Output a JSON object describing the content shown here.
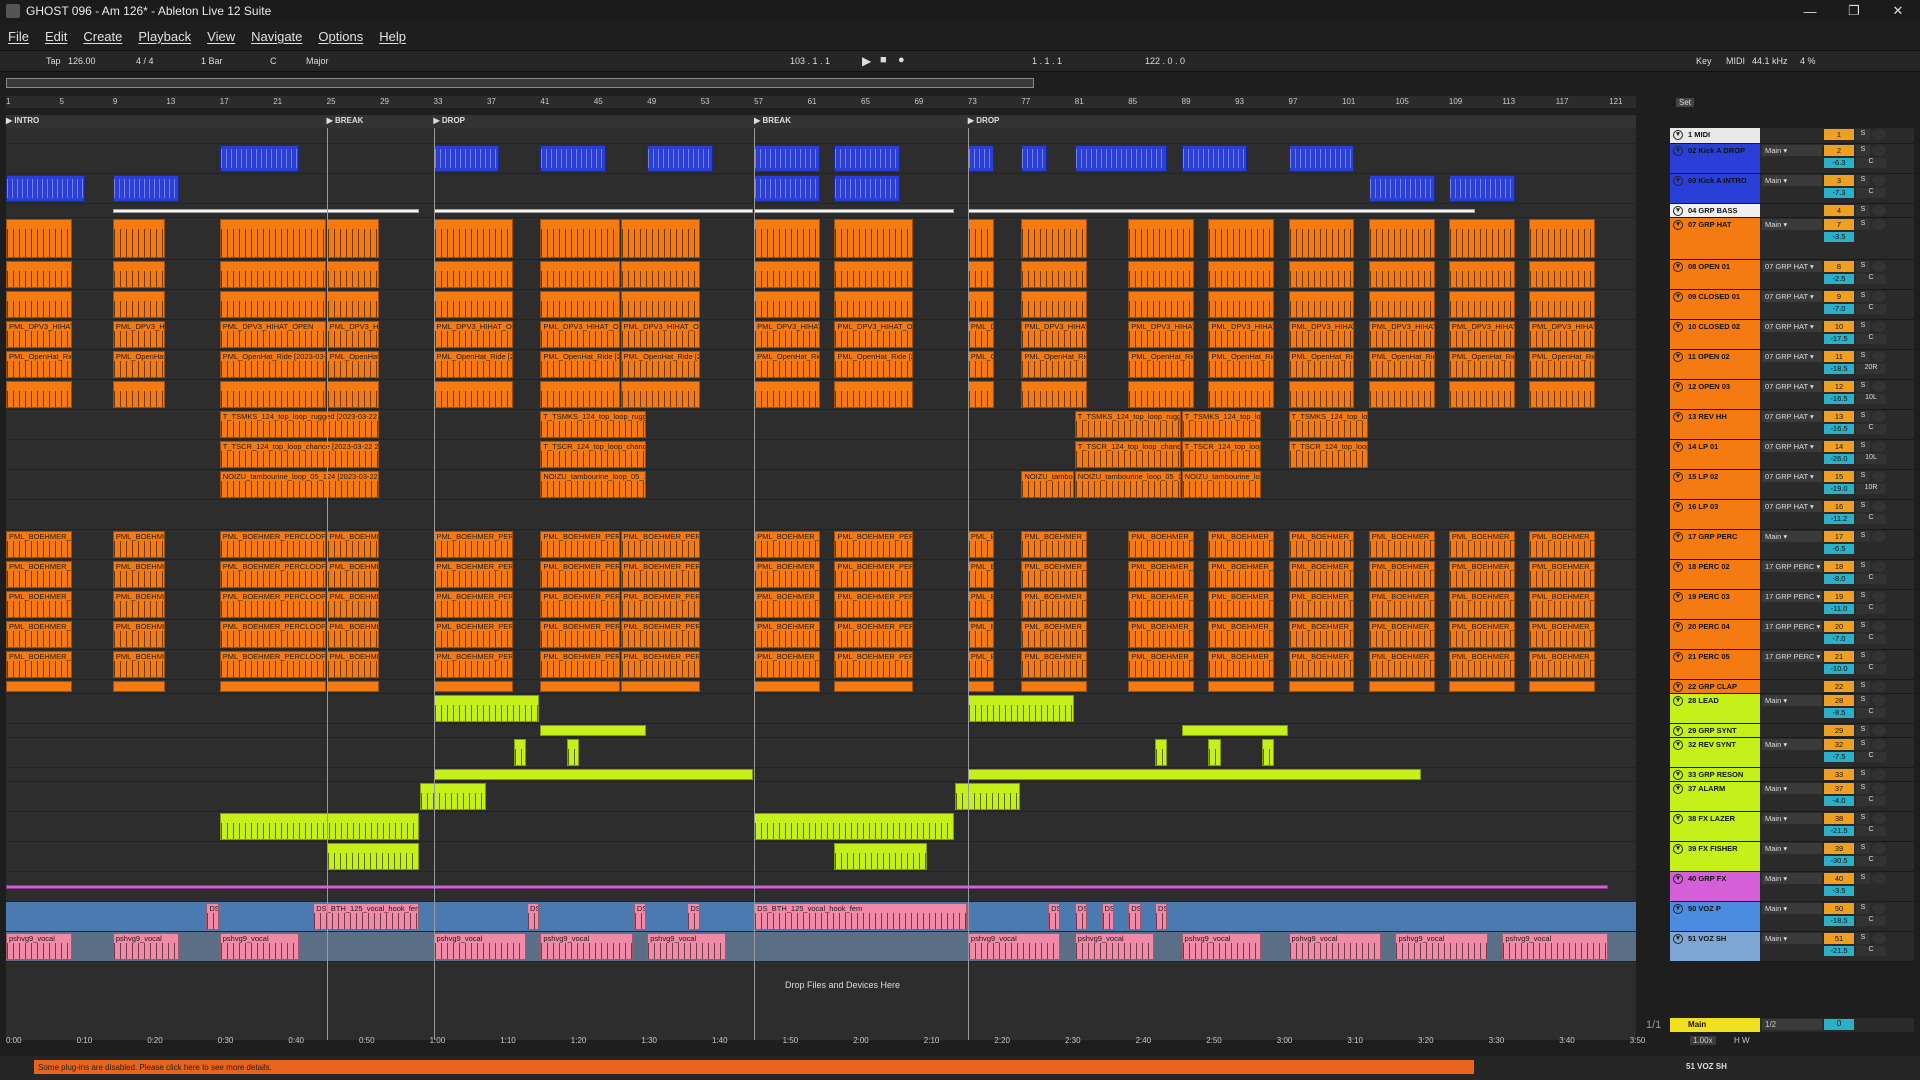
{
  "window": {
    "title": "GHOST 096 - Am 126* - Ableton Live 12 Suite",
    "min": "—",
    "max": "❐",
    "close": "✕"
  },
  "menu": [
    "File",
    "Edit",
    "Create",
    "View",
    "Playback",
    "Navigate",
    "Options",
    "Help"
  ],
  "transport": {
    "tap": "Tap",
    "tempo": "126.00",
    "signature": "4 / 4",
    "quant": "1 Bar",
    "key": "C",
    "scale": "Major",
    "position": "103 .  1 .  1",
    "loop_start": "1 .  1 .  1",
    "loop_len": "122 .  0 .  0",
    "key_label": "Key",
    "midi_label": "MIDI",
    "samplerate": "44.1 kHz",
    "cpu": "4 %"
  },
  "bar_labels": [
    "1",
    "5",
    "9",
    "13",
    "17",
    "21",
    "25",
    "29",
    "33",
    "37",
    "41",
    "45",
    "49",
    "53",
    "57",
    "61",
    "65",
    "69",
    "73",
    "77",
    "81",
    "85",
    "89",
    "93",
    "97",
    "101",
    "105",
    "109",
    "113",
    "117",
    "121"
  ],
  "locators": [
    {
      "label": "INTRO",
      "bar": 1
    },
    {
      "label": "BREAK",
      "bar": 25
    },
    {
      "label": "DROP",
      "bar": 33
    },
    {
      "label": "BREAK",
      "bar": 57
    },
    {
      "label": "DROP",
      "bar": 73
    }
  ],
  "time_labels": [
    "0:00",
    "0:10",
    "0:20",
    "0:30",
    "0:40",
    "0:50",
    "1:00",
    "1:10",
    "1:20",
    "1:30",
    "1:40",
    "1:50",
    "2:00",
    "2:10",
    "2:20",
    "2:30",
    "2:40",
    "2:50",
    "3:00",
    "3:10",
    "3:20",
    "3:30",
    "3:40",
    "3:50"
  ],
  "set_label": "Set",
  "drop_text": "Drop Files and Devices Here",
  "page_count": "1/1",
  "tracks": [
    {
      "name": "1 MIDI",
      "color": "#e8e8e8",
      "h": 16,
      "num": "1",
      "route": "",
      "vol": "",
      "pan": ""
    },
    {
      "name": "02 Kick A DROP",
      "color": "#2a3fd8",
      "h": 30,
      "num": "2",
      "route": "Main",
      "vol": "-6.3",
      "pan": "C"
    },
    {
      "name": "03 Kick A INTRO",
      "color": "#2a3fd8",
      "h": 30,
      "num": "3",
      "route": "Main",
      "vol": "-7.3",
      "pan": "C"
    },
    {
      "name": "04 GRP BASS",
      "color": "#f0f0f0",
      "h": 14,
      "num": "4",
      "route": "",
      "vol": "",
      "pan": ""
    },
    {
      "name": "07 GRP HAT",
      "color": "#f57a12",
      "h": 42,
      "num": "7",
      "route": "Main",
      "vol": "-3.5",
      "pan": ""
    },
    {
      "name": "08 OPEN 01",
      "color": "#f57a12",
      "h": 30,
      "num": "8",
      "route": "07 GRP HAT",
      "vol": "-2.5",
      "pan": "C"
    },
    {
      "name": "09 CLOSED 01",
      "color": "#f57a12",
      "h": 30,
      "num": "9",
      "route": "07 GRP HAT",
      "vol": "-7.0",
      "pan": "C"
    },
    {
      "name": "10 CLOSED 02",
      "color": "#f57a12",
      "h": 30,
      "num": "10",
      "route": "07 GRP HAT",
      "vol": "-17.5",
      "pan": "C"
    },
    {
      "name": "11 OPEN 02",
      "color": "#f57a12",
      "h": 30,
      "num": "11",
      "route": "07 GRP HAT",
      "vol": "-18.5",
      "pan": "20R"
    },
    {
      "name": "12 OPEN 03",
      "color": "#f57a12",
      "h": 30,
      "num": "12",
      "route": "07 GRP HAT",
      "vol": "-16.5",
      "pan": "10L"
    },
    {
      "name": "13 REV HH",
      "color": "#f57a12",
      "h": 30,
      "num": "13",
      "route": "07 GRP HAT",
      "vol": "-16.5",
      "pan": "C"
    },
    {
      "name": "14 LP 01",
      "color": "#f57a12",
      "h": 30,
      "num": "14",
      "route": "07 GRP HAT",
      "vol": "-26.0",
      "pan": "10L"
    },
    {
      "name": "15 LP 02",
      "color": "#f57a12",
      "h": 30,
      "num": "15",
      "route": "07 GRP HAT",
      "vol": "-19.0",
      "pan": "10R"
    },
    {
      "name": "16 LP 03",
      "color": "#f57a12",
      "h": 30,
      "num": "16",
      "route": "07 GRP HAT",
      "vol": "-11.2",
      "pan": "C"
    },
    {
      "name": "17 GRP PERC",
      "color": "#f57a12",
      "h": 30,
      "num": "17",
      "route": "Main",
      "vol": "-6.5",
      "pan": ""
    },
    {
      "name": "18 PERC 02",
      "color": "#f57a12",
      "h": 30,
      "num": "18",
      "route": "17 GRP PERC",
      "vol": "-8.0",
      "pan": "C"
    },
    {
      "name": "19 PERC 03",
      "color": "#f57a12",
      "h": 30,
      "num": "19",
      "route": "17 GRP PERC",
      "vol": "-11.0",
      "pan": "C"
    },
    {
      "name": "20 PERC 04",
      "color": "#f57a12",
      "h": 30,
      "num": "20",
      "route": "17 GRP PERC",
      "vol": "-7.0",
      "pan": "C"
    },
    {
      "name": "21 PERC 05",
      "color": "#f57a12",
      "h": 30,
      "num": "21",
      "route": "17 GRP PERC",
      "vol": "-10.0",
      "pan": "C"
    },
    {
      "name": "22 GRP CLAP",
      "color": "#f57a12",
      "h": 14,
      "num": "22",
      "route": "",
      "vol": "",
      "pan": ""
    },
    {
      "name": "28 LEAD",
      "color": "#c6f01a",
      "h": 30,
      "num": "28",
      "route": "Main",
      "vol": "-8.5",
      "pan": "C"
    },
    {
      "name": "29 GRP SYNT",
      "color": "#c6f01a",
      "h": 14,
      "num": "29",
      "route": "",
      "vol": "",
      "pan": ""
    },
    {
      "name": "32 REV SYNT",
      "color": "#c6f01a",
      "h": 30,
      "num": "32",
      "route": "Main",
      "vol": "-7.5",
      "pan": "C"
    },
    {
      "name": "33 GRP RESON",
      "color": "#c6f01a",
      "h": 14,
      "num": "33",
      "route": "",
      "vol": "",
      "pan": ""
    },
    {
      "name": "37 ALARM",
      "color": "#c6f01a",
      "h": 30,
      "num": "37",
      "route": "Main",
      "vol": "-4.0",
      "pan": "C"
    },
    {
      "name": "38 FX LAZER",
      "color": "#c6f01a",
      "h": 30,
      "num": "38",
      "route": "Main",
      "vol": "-21.5",
      "pan": "C"
    },
    {
      "name": "39 FX FISHER",
      "color": "#c6f01a",
      "h": 30,
      "num": "39",
      "route": "Main",
      "vol": "-30.5",
      "pan": "C"
    },
    {
      "name": "40 GRP FX",
      "color": "#d45fd8",
      "h": 30,
      "num": "40",
      "route": "Main",
      "vol": "-3.5",
      "pan": ""
    },
    {
      "name": "50 VOZ P",
      "color": "#4a8de0",
      "h": 30,
      "num": "50",
      "route": "Main",
      "vol": "-18.5",
      "pan": "C"
    },
    {
      "name": "51 VOZ SH",
      "color": "#7ea6d4",
      "h": 30,
      "num": "51",
      "route": "Main",
      "vol": "-21.5",
      "pan": "C"
    }
  ],
  "main": {
    "name": "Main",
    "route": "1/2",
    "vol": "0",
    "zoom": "1.00x",
    "hw": "H W"
  },
  "clip_names": {
    "hat1": "PML_DPV3_HIHAT_OPEN",
    "hat2": "PML_OpenHat_Ride [2023-03-22 115323]",
    "hat3": "PML_DPV3_HIHAT_OPEN_012 [2023-03-22 115323]",
    "lp1": "T_TSMKS_124_top_loop_rugged [2023-03-22 2011]",
    "lp2": "T_TSCR_124_top_loop_chance [2023-03-22 20114]",
    "lp3": "NOIZU_tambourine_loop_05_124 [2023-03-22 2011]",
    "perc": "PML_BOEHMER_PERCLOOP",
    "voz": "DS_BTH_125_vocal_hook_fem",
    "voz2": "pshvg9_vocal"
  },
  "status": {
    "warning": "Some plug-ins are disabled. Please click here to see more details.",
    "track": "51 VOZ SH"
  }
}
